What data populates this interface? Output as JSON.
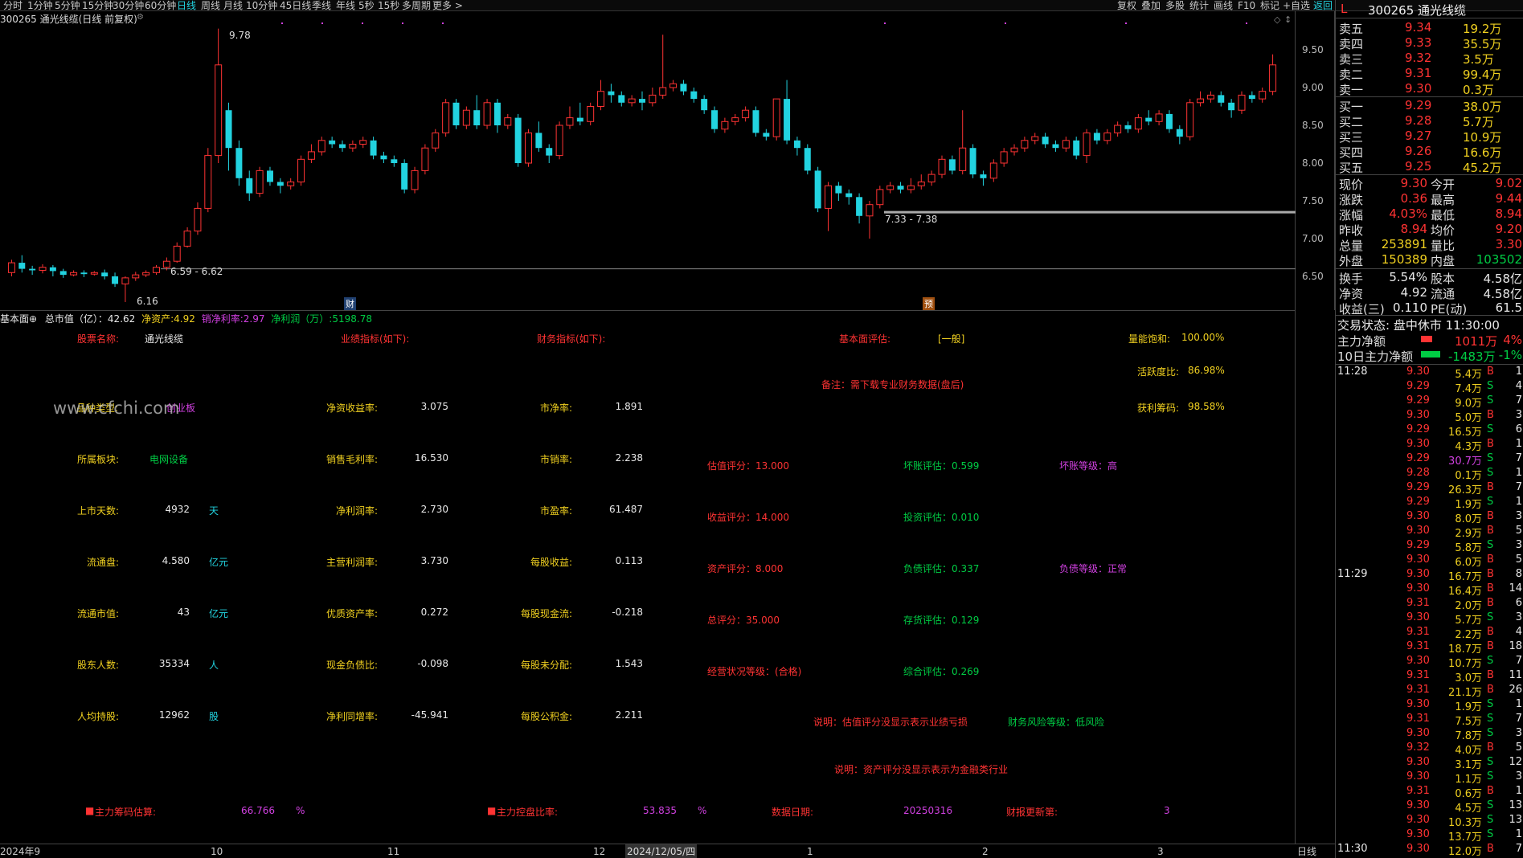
{
  "topbar": {
    "items": [
      "分时",
      "1分钟",
      "5分钟",
      "15分钟",
      "30分钟",
      "60分钟",
      "日线",
      "周线",
      "月线",
      "10分钟",
      "45日线",
      "季线",
      "年线",
      "5秒",
      "15秒",
      "多周期",
      "更多 >"
    ],
    "active": "日线",
    "right_items": [
      "复权",
      "叠加",
      "多股",
      "统计",
      "画线",
      "F10",
      "标记",
      "+自选",
      "返回"
    ]
  },
  "chart": {
    "title": "300265 通光线缆(日线 前复权)",
    "high_label": "9.78",
    "low_label": "6.16",
    "range1": "6.59 - 6.62",
    "range2": "7.33 - 7.38",
    "yaxis": [
      "9.50",
      "9.00",
      "8.50",
      "8.00",
      "7.50",
      "7.00",
      "6.50"
    ],
    "markers": {
      "cai": "财",
      "yu": "预"
    },
    "candles": [
      [
        6.55,
        6.68,
        6.5,
        6.72
      ],
      [
        6.68,
        6.6,
        6.55,
        6.78
      ],
      [
        6.6,
        6.58,
        6.52,
        6.64
      ],
      [
        6.58,
        6.62,
        6.54,
        6.66
      ],
      [
        6.62,
        6.57,
        6.5,
        6.65
      ],
      [
        6.57,
        6.52,
        6.48,
        6.6
      ],
      [
        6.52,
        6.55,
        6.5,
        6.58
      ],
      [
        6.55,
        6.53,
        6.49,
        6.58
      ],
      [
        6.53,
        6.55,
        6.51,
        6.57
      ],
      [
        6.55,
        6.5,
        6.46,
        6.59
      ],
      [
        6.5,
        6.4,
        6.36,
        6.55
      ],
      [
        6.4,
        6.48,
        6.16,
        6.5
      ],
      [
        6.48,
        6.52,
        6.44,
        6.56
      ],
      [
        6.52,
        6.55,
        6.49,
        6.58
      ],
      [
        6.55,
        6.62,
        6.52,
        6.65
      ],
      [
        6.62,
        6.7,
        6.58,
        6.75
      ],
      [
        6.7,
        6.9,
        6.68,
        6.95
      ],
      [
        6.9,
        7.1,
        6.88,
        7.15
      ],
      [
        7.1,
        7.4,
        7.05,
        7.48
      ],
      [
        7.4,
        8.1,
        7.35,
        8.2
      ],
      [
        8.1,
        9.3,
        8.0,
        9.78
      ],
      [
        8.7,
        8.2,
        7.9,
        8.8
      ],
      [
        8.2,
        7.8,
        7.7,
        8.3
      ],
      [
        7.8,
        7.6,
        7.5,
        7.9
      ],
      [
        7.6,
        7.9,
        7.55,
        7.95
      ],
      [
        7.9,
        7.75,
        7.7,
        7.95
      ],
      [
        7.75,
        7.7,
        7.6,
        7.8
      ],
      [
        7.7,
        7.75,
        7.65,
        7.8
      ],
      [
        7.75,
        8.05,
        7.7,
        8.1
      ],
      [
        8.05,
        8.15,
        8.0,
        8.25
      ],
      [
        8.15,
        8.3,
        8.1,
        8.35
      ],
      [
        8.3,
        8.25,
        8.2,
        8.35
      ],
      [
        8.25,
        8.2,
        8.15,
        8.3
      ],
      [
        8.2,
        8.25,
        8.15,
        8.3
      ],
      [
        8.25,
        8.3,
        8.2,
        8.35
      ],
      [
        8.3,
        8.1,
        8.05,
        8.35
      ],
      [
        8.1,
        8.05,
        8.0,
        8.15
      ],
      [
        8.05,
        8.0,
        7.95,
        8.1
      ],
      [
        8.0,
        7.65,
        7.6,
        8.05
      ],
      [
        7.65,
        7.9,
        7.6,
        7.95
      ],
      [
        7.9,
        8.2,
        7.85,
        8.25
      ],
      [
        8.2,
        8.4,
        8.15,
        8.45
      ],
      [
        8.4,
        8.8,
        8.35,
        8.85
      ],
      [
        8.8,
        8.5,
        8.45,
        8.85
      ],
      [
        8.5,
        8.7,
        8.45,
        8.75
      ],
      [
        8.7,
        8.5,
        8.45,
        8.9
      ],
      [
        8.5,
        8.8,
        8.45,
        8.85
      ],
      [
        8.8,
        8.5,
        8.4,
        8.85
      ],
      [
        8.5,
        8.6,
        8.45,
        8.65
      ],
      [
        8.6,
        8.0,
        7.95,
        8.65
      ],
      [
        8.0,
        8.4,
        7.95,
        8.45
      ],
      [
        8.4,
        8.2,
        8.15,
        8.55
      ],
      [
        8.2,
        8.1,
        8.0,
        8.25
      ],
      [
        8.1,
        8.5,
        8.05,
        8.55
      ],
      [
        8.5,
        8.6,
        8.45,
        8.75
      ],
      [
        8.6,
        8.55,
        8.5,
        8.8
      ],
      [
        8.55,
        8.75,
        8.5,
        8.8
      ],
      [
        8.75,
        8.95,
        8.7,
        9.1
      ],
      [
        8.95,
        8.9,
        8.8,
        9.05
      ],
      [
        8.9,
        8.8,
        8.75,
        8.95
      ],
      [
        8.8,
        8.85,
        8.75,
        8.9
      ],
      [
        8.85,
        8.8,
        8.7,
        8.95
      ],
      [
        8.8,
        8.9,
        8.75,
        9.0
      ],
      [
        8.9,
        9.0,
        8.85,
        9.7
      ],
      [
        9.0,
        9.05,
        8.95,
        9.1
      ],
      [
        9.05,
        8.95,
        8.9,
        9.1
      ],
      [
        8.95,
        8.85,
        8.8,
        9.0
      ],
      [
        8.85,
        8.7,
        8.65,
        8.9
      ],
      [
        8.7,
        8.45,
        8.4,
        8.75
      ],
      [
        8.45,
        8.55,
        8.4,
        8.6
      ],
      [
        8.55,
        8.6,
        8.5,
        8.65
      ],
      [
        8.6,
        8.7,
        8.55,
        8.75
      ],
      [
        8.7,
        8.4,
        8.35,
        8.75
      ],
      [
        8.4,
        8.35,
        8.3,
        8.45
      ],
      [
        8.35,
        8.85,
        8.3,
        8.85
      ],
      [
        8.85,
        8.3,
        8.25,
        9.1
      ],
      [
        8.3,
        8.2,
        8.1,
        8.35
      ],
      [
        8.2,
        7.9,
        7.85,
        8.25
      ],
      [
        7.9,
        7.4,
        7.35,
        7.95
      ],
      [
        7.4,
        7.7,
        7.1,
        7.75
      ],
      [
        7.7,
        7.6,
        7.5,
        7.75
      ],
      [
        7.6,
        7.55,
        7.45,
        7.65
      ],
      [
        7.55,
        7.3,
        7.2,
        7.6
      ],
      [
        7.3,
        7.45,
        7.0,
        7.5
      ],
      [
        7.45,
        7.65,
        7.4,
        7.7
      ],
      [
        7.65,
        7.7,
        7.6,
        7.75
      ],
      [
        7.7,
        7.65,
        7.6,
        7.75
      ],
      [
        7.65,
        7.7,
        7.6,
        7.8
      ],
      [
        7.7,
        7.75,
        7.65,
        7.85
      ],
      [
        7.75,
        7.85,
        7.7,
        7.9
      ],
      [
        7.85,
        8.05,
        7.8,
        8.1
      ],
      [
        8.05,
        7.9,
        7.85,
        8.1
      ],
      [
        7.9,
        8.2,
        7.85,
        8.7
      ],
      [
        8.2,
        7.85,
        7.8,
        8.25
      ],
      [
        7.85,
        7.8,
        7.7,
        7.9
      ],
      [
        7.8,
        8.0,
        7.75,
        8.05
      ],
      [
        8.0,
        8.15,
        7.95,
        8.2
      ],
      [
        8.15,
        8.2,
        8.1,
        8.25
      ],
      [
        8.2,
        8.3,
        8.15,
        8.35
      ],
      [
        8.3,
        8.35,
        8.25,
        8.4
      ],
      [
        8.35,
        8.25,
        8.2,
        8.4
      ],
      [
        8.25,
        8.2,
        8.15,
        8.3
      ],
      [
        8.2,
        8.3,
        8.15,
        8.35
      ],
      [
        8.3,
        8.1,
        8.05,
        8.35
      ],
      [
        8.1,
        8.4,
        8.0,
        8.45
      ],
      [
        8.4,
        8.3,
        8.25,
        8.45
      ],
      [
        8.3,
        8.4,
        8.25,
        8.45
      ],
      [
        8.4,
        8.5,
        8.35,
        8.55
      ],
      [
        8.5,
        8.45,
        8.4,
        8.55
      ],
      [
        8.45,
        8.6,
        8.4,
        8.65
      ],
      [
        8.6,
        8.55,
        8.5,
        8.7
      ],
      [
        8.55,
        8.65,
        8.5,
        8.7
      ],
      [
        8.65,
        8.45,
        8.4,
        8.7
      ],
      [
        8.45,
        8.35,
        8.25,
        8.5
      ],
      [
        8.35,
        8.8,
        8.3,
        8.85
      ],
      [
        8.8,
        8.85,
        8.75,
        8.95
      ],
      [
        8.85,
        8.9,
        8.8,
        8.95
      ],
      [
        8.9,
        8.8,
        8.75,
        8.95
      ],
      [
        8.8,
        8.7,
        8.6,
        8.85
      ],
      [
        8.7,
        8.9,
        8.65,
        8.95
      ],
      [
        8.9,
        8.85,
        8.8,
        8.95
      ],
      [
        8.85,
        8.95,
        8.8,
        9.0
      ],
      [
        8.95,
        9.3,
        8.9,
        9.44
      ]
    ]
  },
  "fund": {
    "header": {
      "icon": "基本面⊕",
      "zongshizhi_label": "总市值（亿）",
      "zongshizhi": "42.62",
      "jzc_label": "净资产:",
      "jzc": "4.92",
      "xsjll_label": "销净利率:",
      "xsjll": "2.97",
      "jlr_label": "净利润（万）:",
      "jlr": "5198.78"
    },
    "r1": {
      "a": "股票名称:",
      "b": "通光线缆",
      "c": "业绩指标(如下):",
      "d": "财务指标(如下):",
      "e": "基本面评估:",
      "f": "[一般]",
      "g": "量能饱和:",
      "h": "100.00%"
    },
    "note": "备注：需下载专业财务数据(盘后)",
    "hy": {
      "label": "活跃度比:",
      "value": "86.98%"
    },
    "hl": {
      "label": "获利筹码:",
      "value": "98.58%"
    },
    "pz": {
      "label": "品种类型:",
      "value": "创业板"
    },
    "watermark": "www.cfchi.com",
    "left_rows": [
      {
        "l": "所属板块:",
        "v": "电网设备",
        "u": ""
      },
      {
        "l": "上市天数:",
        "v": "4932",
        "u": "天"
      },
      {
        "l": "流通盘:",
        "v": "4.580",
        "u": "亿元"
      },
      {
        "l": "流通市值:",
        "v": "43",
        "u": "亿元"
      },
      {
        "l": "股东人数:",
        "v": "35334",
        "u": "人"
      },
      {
        "l": "人均持股:",
        "v": "12962",
        "u": "股"
      }
    ],
    "mid1": [
      {
        "l": "净资收益率:",
        "v": "3.075"
      },
      {
        "l": "销售毛利率:",
        "v": "16.530"
      },
      {
        "l": "净利润率:",
        "v": "2.730"
      },
      {
        "l": "主营利润率:",
        "v": "3.730"
      },
      {
        "l": "优质资产率:",
        "v": "0.272"
      },
      {
        "l": "现金负债比:",
        "v": "-0.098"
      },
      {
        "l": "净利同增率:",
        "v": "-45.941"
      }
    ],
    "mid2": [
      {
        "l": "市净率:",
        "v": "1.891"
      },
      {
        "l": "市销率:",
        "v": "2.238"
      },
      {
        "l": "市盈率:",
        "v": "61.487"
      },
      {
        "l": "每股收益:",
        "v": "0.113"
      },
      {
        "l": "每股现金流:",
        "v": "-0.218"
      },
      {
        "l": "每股未分配:",
        "v": "1.543"
      },
      {
        "l": "每股公积金:",
        "v": "2.211"
      }
    ],
    "score": [
      "估值评分：13.000",
      "收益评分：14.000",
      "资产评分：8.000",
      "总评分：35.000",
      "经营状况等级：(合格)"
    ],
    "eval": [
      "坏账评估：0.599",
      "投资评估：0.010",
      "负债评估：0.337",
      "存货评估：0.129",
      "综合评估：0.269"
    ],
    "grade1": "坏账等级：高",
    "grade2": "负债等级：正常",
    "expl1": "说明：估值评分没显示表示业绩亏损",
    "risk": "财务风险等级：低风险",
    "expl2": "说明：资产评分没显示表示为金融类行业",
    "bottom": {
      "a": "主力筹码估算:",
      "av": "66.766",
      "au": "%",
      "b": "主力控盘比率:",
      "bv": "53.835",
      "bu": "%",
      "c": "数据日期:",
      "cv": "20250316",
      "d": "财报更新第:",
      "dv": "3"
    }
  },
  "xaxis": {
    "labels": [
      "2024年9",
      "10",
      "11",
      "12",
      "2024/12/05/四",
      "1",
      "2",
      "3"
    ],
    "right": "日线"
  },
  "right": {
    "title": "300265 通光线缆",
    "L": "L",
    "asks": [
      {
        "l": "卖五",
        "p": "9.34",
        "v": "19.2万"
      },
      {
        "l": "卖四",
        "p": "9.33",
        "v": "35.5万"
      },
      {
        "l": "卖三",
        "p": "9.32",
        "v": "3.5万"
      },
      {
        "l": "卖二",
        "p": "9.31",
        "v": "99.4万"
      },
      {
        "l": "卖一",
        "p": "9.30",
        "v": "0.3万"
      }
    ],
    "bids": [
      {
        "l": "买一",
        "p": "9.29",
        "v": "38.0万"
      },
      {
        "l": "买二",
        "p": "9.28",
        "v": "5.7万"
      },
      {
        "l": "买三",
        "p": "9.27",
        "v": "10.9万"
      },
      {
        "l": "买四",
        "p": "9.26",
        "v": "16.6万"
      },
      {
        "l": "买五",
        "p": "9.25",
        "v": "45.2万"
      }
    ],
    "quotes": [
      {
        "l1": "现价",
        "v1": "9.30",
        "l2": "今开",
        "v2": "9.02"
      },
      {
        "l1": "涨跌",
        "v1": "0.36",
        "l2": "最高",
        "v2": "9.44"
      },
      {
        "l1": "涨幅",
        "v1": "4.03%",
        "l2": "最低",
        "v2": "8.94"
      },
      {
        "l1": "昨收",
        "v1": "8.94",
        "l2": "均价",
        "v2": "9.20"
      },
      {
        "l1": "总量",
        "v1": "253891",
        "l2": "量比",
        "v2": "3.30"
      },
      {
        "l1": "外盘",
        "v1": "150389",
        "l2": "内盘",
        "v2": "103502"
      }
    ],
    "quotes2": [
      {
        "l1": "换手",
        "v1": "5.54%",
        "l2": "股本",
        "v2": "4.58亿"
      },
      {
        "l1": "净资",
        "v1": "4.92",
        "l2": "流通",
        "v2": "4.58亿"
      },
      {
        "l1": "收益(三)",
        "v1": "0.110",
        "l2": "PE(动)",
        "v2": "61.5"
      }
    ],
    "status": "交易状态: 盘中休市 11:30:00",
    "flow1": {
      "l": "主力净额",
      "v": "1011万",
      "p": "4%"
    },
    "flow2": {
      "l": "10日主力净额",
      "v": "-1483万",
      "p": "-1%"
    },
    "ticks": [
      {
        "t": "11:28",
        "p": "9.30",
        "v": "5.4万",
        "s": "B",
        "n": "1"
      },
      {
        "t": "",
        "p": "9.29",
        "v": "7.4万",
        "s": "S",
        "n": "4"
      },
      {
        "t": "",
        "p": "9.29",
        "v": "9.0万",
        "s": "S",
        "n": "7"
      },
      {
        "t": "",
        "p": "9.30",
        "v": "5.0万",
        "s": "B",
        "n": "3"
      },
      {
        "t": "",
        "p": "9.29",
        "v": "16.5万",
        "s": "S",
        "n": "6"
      },
      {
        "t": "",
        "p": "9.30",
        "v": "4.3万",
        "s": "B",
        "n": "1"
      },
      {
        "t": "",
        "p": "9.29",
        "v": "30.7万",
        "s": "S",
        "n": "7"
      },
      {
        "t": "",
        "p": "9.28",
        "v": "0.1万",
        "s": "S",
        "n": "1"
      },
      {
        "t": "",
        "p": "9.29",
        "v": "26.3万",
        "s": "B",
        "n": "7"
      },
      {
        "t": "",
        "p": "9.29",
        "v": "1.9万",
        "s": "S",
        "n": "1"
      },
      {
        "t": "",
        "p": "9.30",
        "v": "8.0万",
        "s": "B",
        "n": "3"
      },
      {
        "t": "",
        "p": "9.30",
        "v": "2.9万",
        "s": "B",
        "n": "5"
      },
      {
        "t": "",
        "p": "9.29",
        "v": "5.8万",
        "s": "S",
        "n": "3"
      },
      {
        "t": "",
        "p": "9.30",
        "v": "6.0万",
        "s": "B",
        "n": "5"
      },
      {
        "t": "11:29",
        "p": "9.30",
        "v": "16.7万",
        "s": "B",
        "n": "8"
      },
      {
        "t": "",
        "p": "9.30",
        "v": "16.4万",
        "s": "B",
        "n": "14"
      },
      {
        "t": "",
        "p": "9.31",
        "v": "2.0万",
        "s": "B",
        "n": "6"
      },
      {
        "t": "",
        "p": "9.30",
        "v": "5.7万",
        "s": "S",
        "n": "3"
      },
      {
        "t": "",
        "p": "9.31",
        "v": "2.2万",
        "s": "B",
        "n": "4"
      },
      {
        "t": "",
        "p": "9.31",
        "v": "18.7万",
        "s": "B",
        "n": "18"
      },
      {
        "t": "",
        "p": "9.30",
        "v": "10.7万",
        "s": "S",
        "n": "7"
      },
      {
        "t": "",
        "p": "9.31",
        "v": "3.0万",
        "s": "B",
        "n": "11"
      },
      {
        "t": "",
        "p": "9.31",
        "v": "21.1万",
        "s": "B",
        "n": "26"
      },
      {
        "t": "",
        "p": "9.30",
        "v": "1.9万",
        "s": "S",
        "n": "1"
      },
      {
        "t": "",
        "p": "9.31",
        "v": "7.5万",
        "s": "S",
        "n": "7"
      },
      {
        "t": "",
        "p": "9.30",
        "v": "7.8万",
        "s": "S",
        "n": "3"
      },
      {
        "t": "",
        "p": "9.32",
        "v": "4.0万",
        "s": "B",
        "n": "5"
      },
      {
        "t": "",
        "p": "9.30",
        "v": "3.1万",
        "s": "S",
        "n": "12"
      },
      {
        "t": "",
        "p": "9.30",
        "v": "1.1万",
        "s": "S",
        "n": "3"
      },
      {
        "t": "",
        "p": "9.31",
        "v": "0.6万",
        "s": "B",
        "n": "1"
      },
      {
        "t": "",
        "p": "9.30",
        "v": "4.5万",
        "s": "S",
        "n": "13"
      },
      {
        "t": "",
        "p": "9.30",
        "v": "10.3万",
        "s": "S",
        "n": "13"
      },
      {
        "t": "",
        "p": "9.30",
        "v": "13.7万",
        "s": "S",
        "n": "1"
      },
      {
        "t": "11:30",
        "p": "9.30",
        "v": "12.0万",
        "s": "B",
        "n": "7"
      }
    ]
  }
}
